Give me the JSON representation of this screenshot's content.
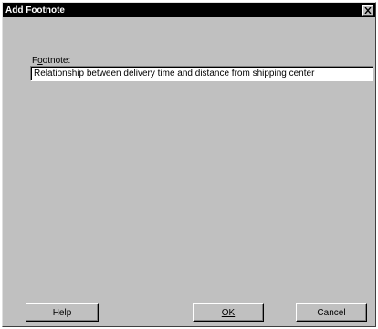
{
  "window": {
    "title": "Add Footnote",
    "close_icon": "close-x-icon"
  },
  "footnote": {
    "label_accel": "o",
    "label_prefix": "F",
    "label_suffix": "otnote:",
    "value": "Relationship between delivery time and distance from shipping center"
  },
  "buttons": {
    "help_label": "Help",
    "ok_label": "OK",
    "cancel_label": "Cancel"
  },
  "colors": {
    "dialog_background": "#c0c0c0",
    "titlebar_background": "#000000",
    "titlebar_text": "#ffffff"
  }
}
